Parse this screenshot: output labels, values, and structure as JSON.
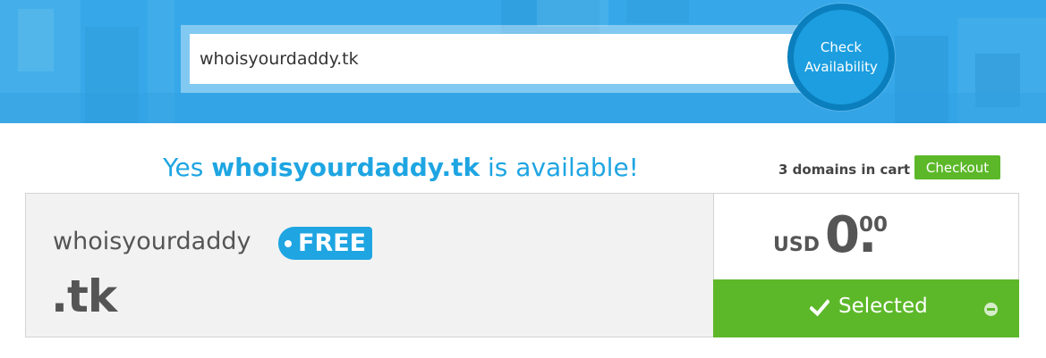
{
  "search": {
    "value": "whoisyourdaddy.tk",
    "button_line1": "Check",
    "button_line2": "Availability"
  },
  "result": {
    "prefix": "Yes",
    "domain": "whoisyourdaddy.tk",
    "suffix": "is available!"
  },
  "cart": {
    "count_text": "3 domains in cart",
    "checkout_label": "Checkout"
  },
  "card": {
    "name": "whoisyourdaddy",
    "tld": ".tk",
    "badge": "FREE",
    "currency": "USD",
    "amount": "0.",
    "cents": "00",
    "selected_label": "Selected"
  },
  "colors": {
    "accent_blue": "#1ea5e2",
    "hero_blue": "#37a9ea",
    "green": "#5cb829"
  },
  "icons": {
    "selected": "check-icon",
    "remove": "minus-circle-icon"
  }
}
